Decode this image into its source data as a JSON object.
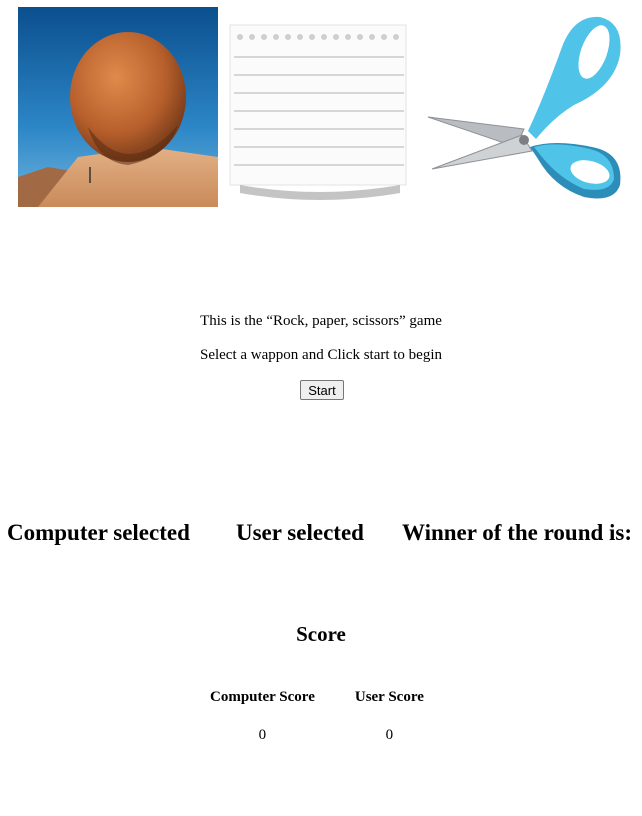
{
  "weapons": [
    {
      "id": "rock",
      "icon": "rock-image"
    },
    {
      "id": "paper",
      "icon": "paper-image"
    },
    {
      "id": "scissors",
      "icon": "scissors-image"
    }
  ],
  "intro": {
    "title": "This is the “Rock, paper, scissors” game",
    "instructions": "Select a wappon and Click start to begin",
    "start_label": "Start"
  },
  "round": {
    "computer_selected_label": "Computer selected",
    "user_selected_label": "User selected",
    "winner_label": "Winner of the round is:"
  },
  "score": {
    "title": "Score",
    "computer_label": "Computer Score",
    "user_label": "User Score",
    "computer_value": "0",
    "user_value": "0"
  },
  "colors": {
    "sky": "#1d6fb0",
    "rock": "#c06a35",
    "sand": "#d9a274",
    "scissors_handle": "#4fc3e8",
    "scissors_blade": "#b9bcc0"
  }
}
